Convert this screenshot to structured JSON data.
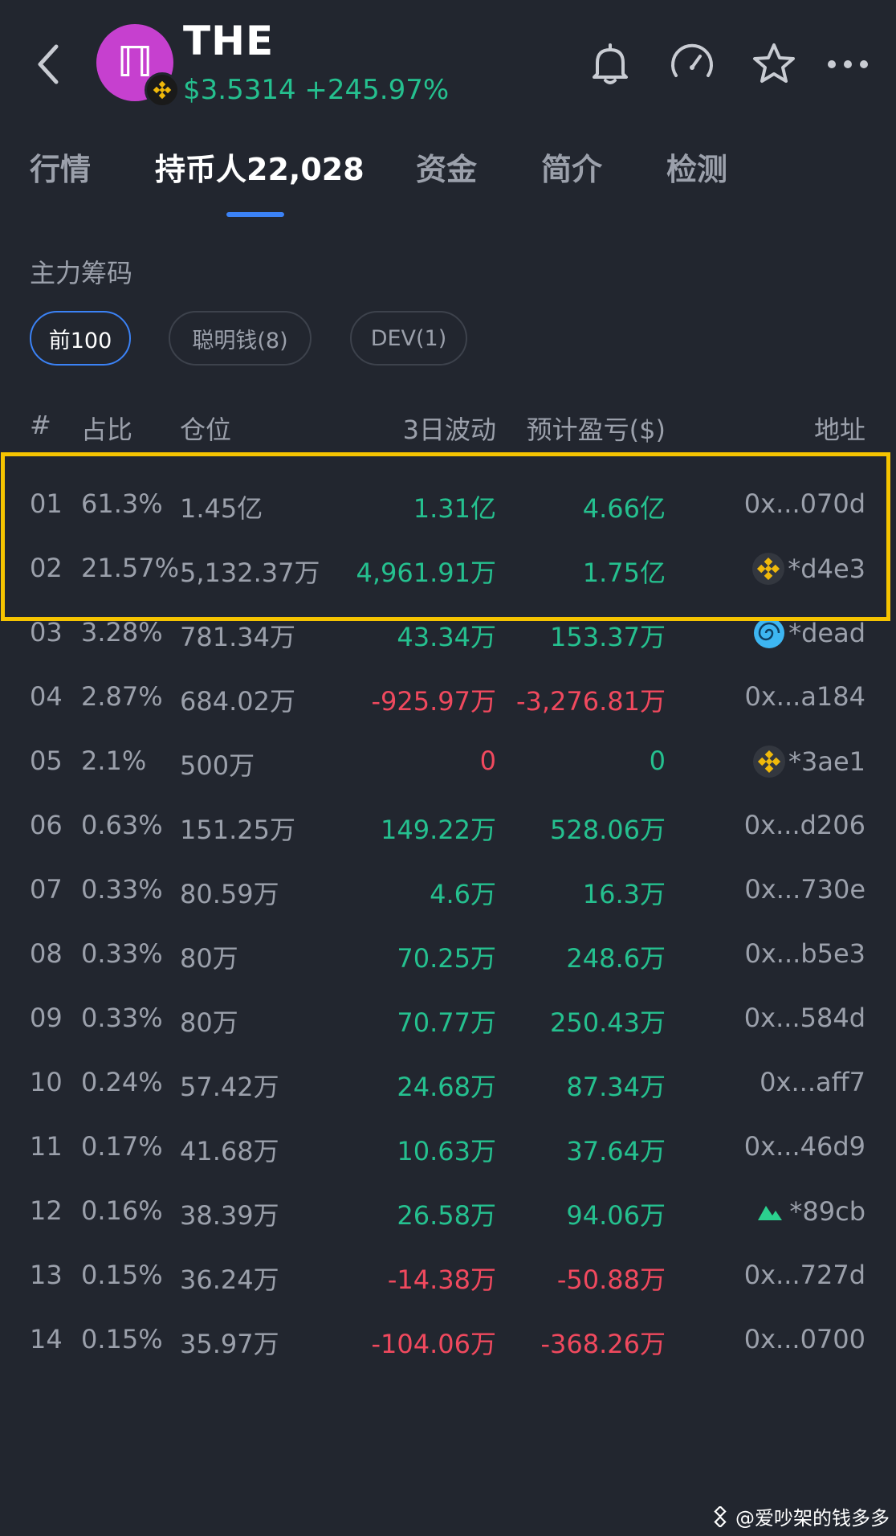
{
  "header": {
    "token_name": "THE",
    "price": "$3.5314",
    "change": "+245.97%",
    "logo_glyph": "ℿ"
  },
  "tabs": [
    {
      "label": "行情"
    },
    {
      "label": "持币人22,028"
    },
    {
      "label": "资金"
    },
    {
      "label": "简介"
    },
    {
      "label": "检测"
    }
  ],
  "section_title": "主力筹码",
  "filters": [
    {
      "label": "前100"
    },
    {
      "label": "聪明钱(8)"
    },
    {
      "label": "DEV(1)"
    }
  ],
  "table": {
    "headers": {
      "num": "#",
      "pct": "占比",
      "pos": "仓位",
      "chg": "3日波动",
      "pnl": "预计盈亏($)",
      "addr": "地址"
    },
    "rows": [
      {
        "num": "01",
        "pct": "61.3%",
        "pos": "1.45亿",
        "chg": "1.31亿",
        "pnl": "4.66亿",
        "addr": "0x...070d",
        "chg_sign": "pos",
        "pnl_sign": "pos",
        "icon": ""
      },
      {
        "num": "02",
        "pct": "21.57%",
        "pos": "5,132.37万",
        "chg": "4,961.91万",
        "pnl": "1.75亿",
        "addr": "*d4e3",
        "chg_sign": "pos",
        "pnl_sign": "pos",
        "icon": "bnb-icon"
      },
      {
        "num": "03",
        "pct": "3.28%",
        "pos": "781.34万",
        "chg": "43.34万",
        "pnl": "153.37万",
        "addr": "*dead",
        "chg_sign": "pos",
        "pnl_sign": "pos",
        "icon": "swirl-icon"
      },
      {
        "num": "04",
        "pct": "2.87%",
        "pos": "684.02万",
        "chg": "-925.97万",
        "pnl": "-3,276.81万",
        "addr": "0x...a184",
        "chg_sign": "neg",
        "pnl_sign": "neg",
        "icon": ""
      },
      {
        "num": "05",
        "pct": "2.1%",
        "pos": "500万",
        "chg": "0",
        "pnl": "0",
        "addr": "*3ae1",
        "chg_sign": "neg",
        "pnl_sign": "pos",
        "icon": "bnb-icon"
      },
      {
        "num": "06",
        "pct": "0.63%",
        "pos": "151.25万",
        "chg": "149.22万",
        "pnl": "528.06万",
        "addr": "0x...d206",
        "chg_sign": "pos",
        "pnl_sign": "pos",
        "icon": ""
      },
      {
        "num": "07",
        "pct": "0.33%",
        "pos": "80.59万",
        "chg": "4.6万",
        "pnl": "16.3万",
        "addr": "0x...730e",
        "chg_sign": "pos",
        "pnl_sign": "pos",
        "icon": ""
      },
      {
        "num": "08",
        "pct": "0.33%",
        "pos": "80万",
        "chg": "70.25万",
        "pnl": "248.6万",
        "addr": "0x...b5e3",
        "chg_sign": "pos",
        "pnl_sign": "pos",
        "icon": ""
      },
      {
        "num": "09",
        "pct": "0.33%",
        "pos": "80万",
        "chg": "70.77万",
        "pnl": "250.43万",
        "addr": "0x...584d",
        "chg_sign": "pos",
        "pnl_sign": "pos",
        "icon": ""
      },
      {
        "num": "10",
        "pct": "0.24%",
        "pos": "57.42万",
        "chg": "24.68万",
        "pnl": "87.34万",
        "addr": "0x...aff7",
        "chg_sign": "pos",
        "pnl_sign": "pos",
        "icon": ""
      },
      {
        "num": "11",
        "pct": "0.17%",
        "pos": "41.68万",
        "chg": "10.63万",
        "pnl": "37.64万",
        "addr": "0x...46d9",
        "chg_sign": "pos",
        "pnl_sign": "pos",
        "icon": ""
      },
      {
        "num": "12",
        "pct": "0.16%",
        "pos": "38.39万",
        "chg": "26.58万",
        "pnl": "94.06万",
        "addr": "*89cb",
        "chg_sign": "pos",
        "pnl_sign": "pos",
        "icon": "mountain-icon"
      },
      {
        "num": "13",
        "pct": "0.15%",
        "pos": "36.24万",
        "chg": "-14.38万",
        "pnl": "-50.88万",
        "addr": "0x...727d",
        "chg_sign": "neg",
        "pnl_sign": "neg",
        "icon": ""
      },
      {
        "num": "14",
        "pct": "0.15%",
        "pos": "35.97万",
        "chg": "-104.06万",
        "pnl": "-368.26万",
        "addr": "0x...0700",
        "chg_sign": "neg",
        "pnl_sign": "neg",
        "icon": ""
      }
    ]
  },
  "watermark": "@爱吵架的钱多多",
  "colors": {
    "background": "#22262f",
    "positive": "#25c08f",
    "negative": "#f0495e",
    "accent": "#3b82f6",
    "highlight": "#f6c400",
    "logo": "#c640cf"
  }
}
